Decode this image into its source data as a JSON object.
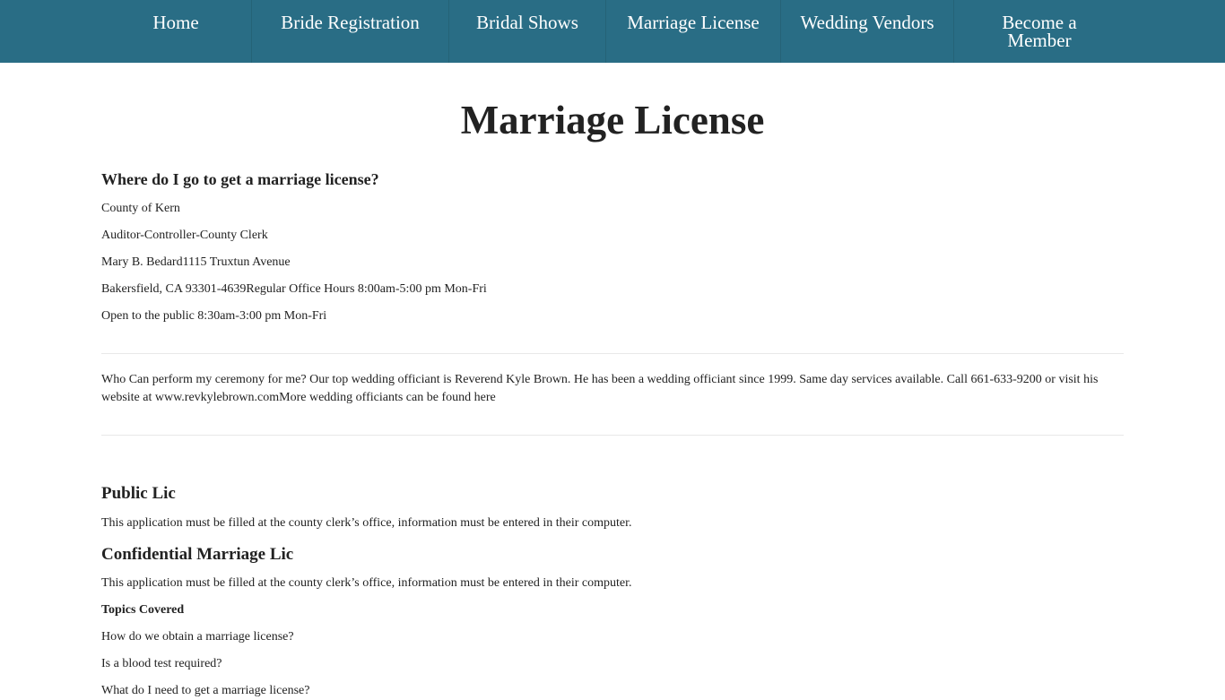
{
  "nav": {
    "items": [
      {
        "label": "Home"
      },
      {
        "label": "Bride Registration"
      },
      {
        "label": "Bridal Shows"
      },
      {
        "label": "Marriage License"
      },
      {
        "label": "Wedding Vendors"
      },
      {
        "label_line1": "Become a",
        "label_line2": "Member"
      }
    ]
  },
  "page": {
    "title": "Marriage License",
    "where_heading": "Where do I go to get a marriage license?",
    "address": [
      "County of Kern",
      "Auditor-Controller-County Clerk",
      "Mary B. Bedard1115 Truxtun Avenue",
      "Bakersfield, CA 93301-4639Regular Office Hours 8:00am-5:00 pm Mon-Fri",
      "Open to the public 8:30am-3:00 pm Mon-Fri"
    ],
    "officiant_text": "Who Can perform my ceremony for me? Our top wedding officiant is Reverend Kyle Brown.  He has been a wedding officiant since 1999.  Same day services available.  Call 661-633-9200 or visit his website at www.revkylebrown.comMore wedding officiants can be found here",
    "public_heading": "Public Lic",
    "public_text": "This application must be filled at the county clerk’s office, information must be entered in their computer.",
    "confidential_heading": "Confidential Marriage Lic",
    "confidential_text": "This application must be filled at the county clerk’s office, information must be entered in their computer.",
    "topics_heading": "Topics Covered",
    "topics": [
      "How do we obtain a marriage license?",
      "Is a blood test required?",
      "What do I need to get a marriage license?"
    ]
  },
  "colors": {
    "nav_bg": "#296d85",
    "text": "#222222",
    "nav_text": "#ffffff"
  }
}
